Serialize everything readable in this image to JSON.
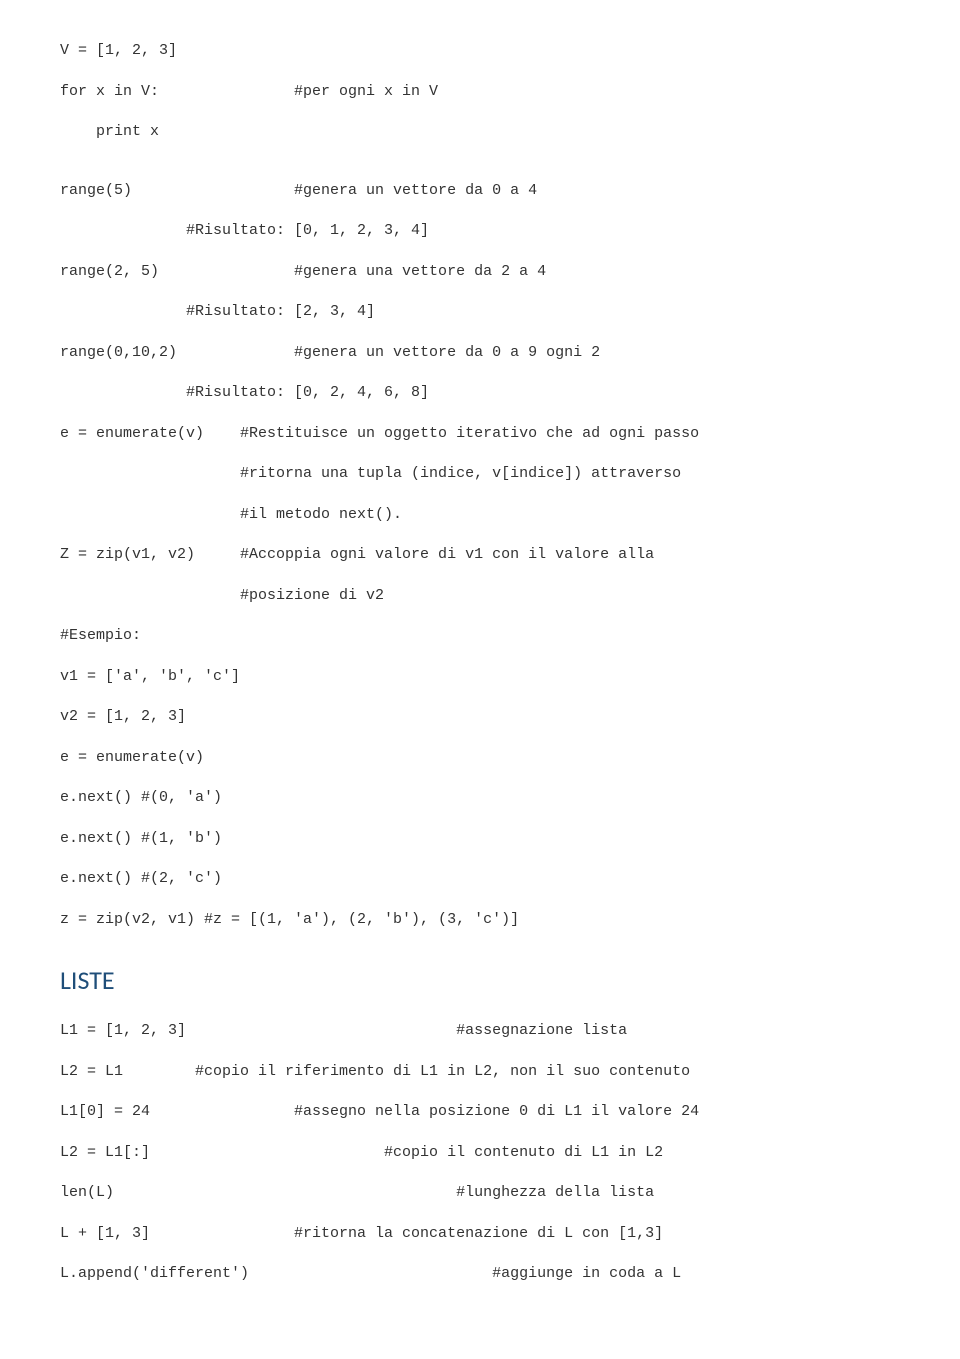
{
  "lines": {
    "l0": "V = [1, 2, 3]",
    "l1": "for x in V:               #per ogni x in V",
    "l2": "    print x",
    "l3": "range(5)                  #genera un vettore da 0 a 4",
    "l4": "              #Risultato: [0, 1, 2, 3, 4]",
    "l5": "range(2, 5)               #genera una vettore da 2 a 4",
    "l6": "              #Risultato: [2, 3, 4]",
    "l7": "range(0,10,2)             #genera un vettore da 0 a 9 ogni 2",
    "l8": "              #Risultato: [0, 2, 4, 6, 8]",
    "l9": "e = enumerate(v)    #Restituisce un oggetto iterativo che ad ogni passo",
    "l10": "                    #ritorna una tupla (indice, v[indice]) attraverso",
    "l11": "                    #il metodo next().",
    "l12": "Z = zip(v1, v2)     #Accoppia ogni valore di v1 con il valore alla",
    "l13": "                    #posizione di v2",
    "l14": "#Esempio:",
    "l15": "v1 = ['a', 'b', 'c']",
    "l16": "v2 = [1, 2, 3]",
    "l17": "e = enumerate(v)",
    "l18": "e.next() #(0, 'a')",
    "l19": "e.next() #(1, 'b')",
    "l20": "e.next() #(2, 'c')",
    "l21": "z = zip(v2, v1) #z = [(1, 'a'), (2, 'b'), (3, 'c')]",
    "l22": "L1 = [1, 2, 3]                              #assegnazione lista",
    "l23": "L2 = L1        #copio il riferimento di L1 in L2, non il suo contenuto",
    "l24": "L1[0] = 24                #assegno nella posizione 0 di L1 il valore 24",
    "l25": "L2 = L1[:]                          #copio il contenuto di L1 in L2",
    "l26": "len(L)                                      #lunghezza della lista",
    "l27": "L + [1, 3]                #ritorna la concatenazione di L con [1,3]",
    "l28": "L.append('different')                           #aggiunge in coda a L"
  },
  "heading": "LISTE"
}
